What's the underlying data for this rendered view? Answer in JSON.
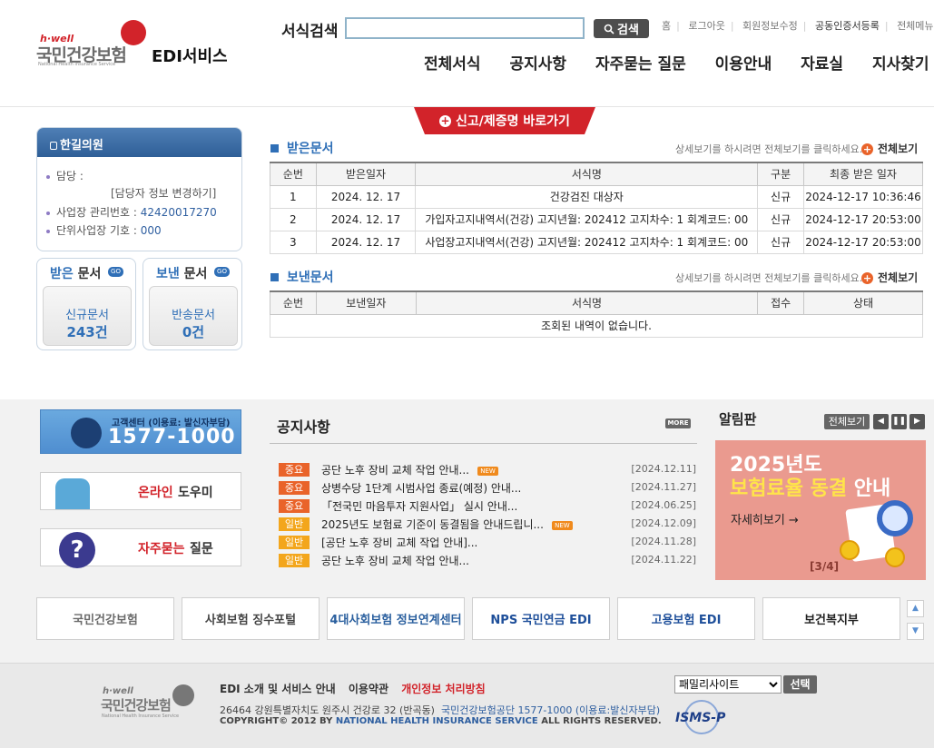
{
  "header": {
    "logo_hwell": "h·well",
    "logo_name": "국민건강보험",
    "logo_en": "National Health Insurance Service",
    "service_title": "EDI서비스",
    "search_label": "서식검색",
    "search_value": "",
    "search_button": "검색",
    "util_links": [
      "홈",
      "로그아웃",
      "회원정보수정",
      "공동인증서등록",
      "전체메뉴"
    ],
    "nav": [
      "전체서식",
      "공지사항",
      "자주묻는 질문",
      "이용안내",
      "자료실",
      "지사찾기"
    ]
  },
  "report_banner": "신고/제증명 바로가기",
  "user": {
    "name": "한길의원",
    "manager_label": "담당 :",
    "manager_change": "[담당자 정보 변경하기]",
    "biz_label": "사업장 관리번호 :",
    "biz_no": "42420017270",
    "unit_label": "단위사업장 기호 :",
    "unit_no": "000"
  },
  "docboxes": {
    "received_title_a": "받은",
    "received_title_b": "문서",
    "received_go": "GO",
    "received_label": "신규문서",
    "received_count": "243건",
    "sent_title_a": "보낸",
    "sent_title_b": "문서",
    "sent_go": "GO",
    "sent_label": "반송문서",
    "sent_count": "0건"
  },
  "received": {
    "title": "받은문서",
    "hint": "상세보기를 하시려면 전체보기를 클릭하세요.",
    "view_all": "전체보기",
    "headers": [
      "순번",
      "받은일자",
      "서식명",
      "구분",
      "최종 받은 일자"
    ],
    "rows": [
      [
        "1",
        "2024. 12. 17",
        "건강검진 대상자",
        "신규",
        "2024-12-17 10:36:46"
      ],
      [
        "2",
        "2024. 12. 17",
        "가입자고지내역서(건강) 고지년월: 202412 고지차수: 1 회계코드: 00",
        "신규",
        "2024-12-17 20:53:00"
      ],
      [
        "3",
        "2024. 12. 17",
        "사업장고지내역서(건강) 고지년월: 202412 고지차수: 1 회계코드: 00",
        "신규",
        "2024-12-17 20:53:00"
      ]
    ]
  },
  "sent": {
    "title": "보낸문서",
    "hint": "상세보기를 하시려면 전체보기를 클릭하세요.",
    "view_all": "전체보기",
    "headers": [
      "순번",
      "보낸일자",
      "서식명",
      "접수",
      "상태"
    ],
    "empty": "조회된 내역이 없습니다."
  },
  "quicklinks": {
    "call_center_label": "고객센터 (이용료: 발신자부담)",
    "call_center_number": "1577-1000",
    "online_help_a": "온라인",
    "online_help_b": "도우미",
    "faq_a": "자주묻는",
    "faq_b": "질문"
  },
  "notice": {
    "title": "공지사항",
    "more": "MORE",
    "items": [
      {
        "tag": "중요",
        "title": "공단 노후 장비 교체 작업 안내...",
        "new": true,
        "date": "[2024.12.11]"
      },
      {
        "tag": "중요",
        "title": "상병수당 1단계 시범사업 종료(예정) 안내...",
        "new": false,
        "date": "[2024.11.27]"
      },
      {
        "tag": "중요",
        "title": "「전국민 마음투자 지원사업」 실시 안내...",
        "new": false,
        "date": "[2024.06.25]"
      },
      {
        "tag": "일반",
        "title": "2025년도 보험료 기준이 동결됨을 안내드립니...",
        "new": true,
        "date": "[2024.12.09]"
      },
      {
        "tag": "일반",
        "title": "[공단 노후 장비 교체 작업 안내]...",
        "new": false,
        "date": "[2024.11.28]"
      },
      {
        "tag": "일반",
        "title": "공단 노후 장비 교체 작업 안내...",
        "new": false,
        "date": "[2024.11.22]"
      }
    ],
    "new_label": "NEW"
  },
  "board": {
    "title": "알림판",
    "view_all": "전체보기",
    "line1": "2025년도",
    "line2a": "보험료율 동결",
    "line2b": "안내",
    "detail": "자세히보기  →",
    "page": "[3/4]"
  },
  "partners": [
    "국민건강보험",
    "사회보험 징수포털",
    "4대사회보험 정보연계센터",
    "NPS 국민연금 EDI",
    "고용보험 EDI",
    "보건복지부"
  ],
  "footer": {
    "menu": [
      "EDI 소개 및 서비스 안내",
      "이용약관",
      "개인정보 처리방침"
    ],
    "address_a": "26464 강원특별자치도 원주시 건강로 32 (반곡동)",
    "address_b": "국민건강보험공단 1577-1000 (이용료:발신자부담)",
    "copyright_a": "COPYRIGHT© 2012 BY",
    "copyright_b": "NATIONAL HEALTH INSURANCE SERVICE",
    "copyright_c": "ALL RIGHTS RESERVED.",
    "family_select": "패밀리사이트",
    "family_button": "선택",
    "isms": "ISMS-P"
  },
  "colors": {
    "brand_red": "#d2232a",
    "accent_blue": "#2f6fb7",
    "tag_important": "#e9632a",
    "tag_general": "#f3a61c"
  }
}
